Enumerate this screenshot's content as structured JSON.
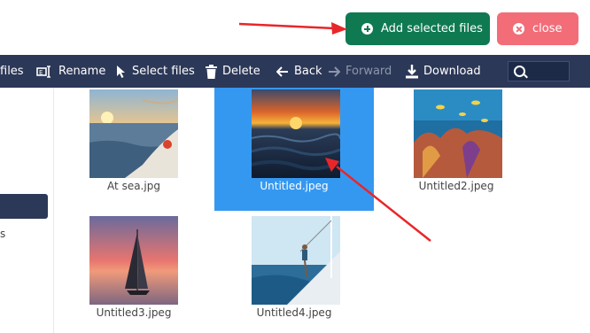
{
  "header": {
    "add_button": "Add selected files",
    "close_button": "close"
  },
  "toolbar": {
    "files": "files",
    "rename": "Rename",
    "select": "Select files",
    "delete": "Delete",
    "back": "Back",
    "forward": "Forward",
    "download": "Download"
  },
  "sidebar": {
    "item_text": "s"
  },
  "files": [
    {
      "name": "At sea.jpg"
    },
    {
      "name": "Untitled.jpeg",
      "selected": true
    },
    {
      "name": "Untitled2.jpeg"
    },
    {
      "name": "Untitled3.jpeg"
    },
    {
      "name": "Untitled4.jpeg"
    }
  ],
  "colors": {
    "toolbar": "#2c3857",
    "add_button": "#0f7a52",
    "close_button": "#f26d78",
    "selection": "#3598f0",
    "annotation_arrow": "#e8262a"
  }
}
